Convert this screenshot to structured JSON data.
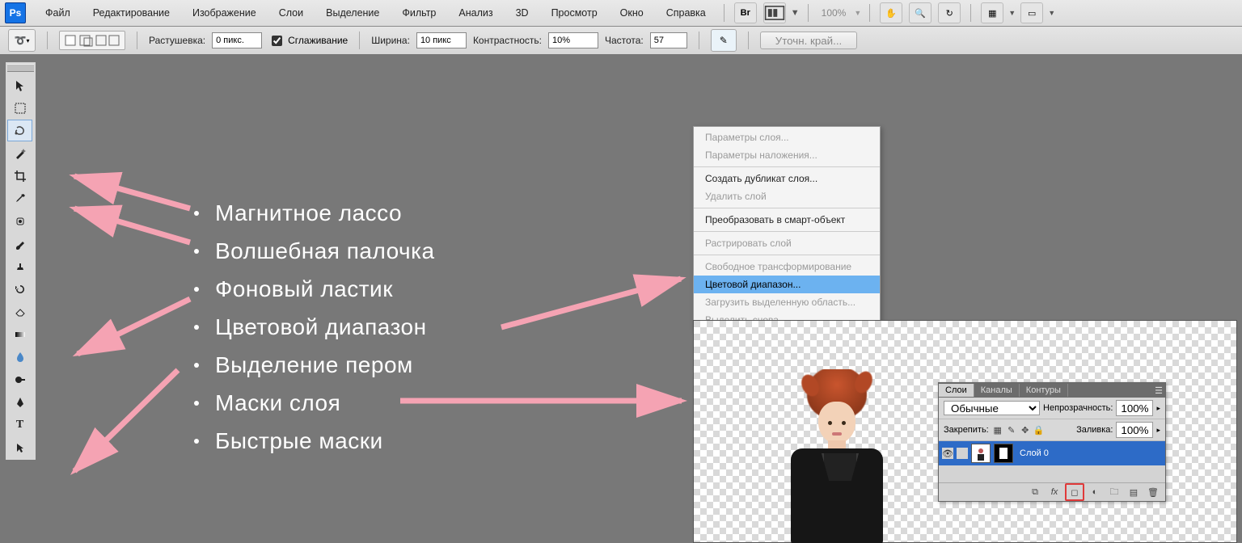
{
  "app": {
    "logo_text": "Ps"
  },
  "menu": {
    "items": [
      "Файл",
      "Редактирование",
      "Изображение",
      "Слои",
      "Выделение",
      "Фильтр",
      "Анализ",
      "3D",
      "Просмотр",
      "Окно",
      "Справка"
    ],
    "zoom": "100%"
  },
  "options": {
    "feather_label": "Растушевка:",
    "feather_value": "0 пикс.",
    "antialias_label": "Сглаживание",
    "width_label": "Ширина:",
    "width_value": "10 пикс",
    "contrast_label": "Контрастность:",
    "contrast_value": "10%",
    "frequency_label": "Частота:",
    "frequency_value": "57",
    "refine_btn": "Уточн. край..."
  },
  "overlay": {
    "items": [
      "Магнитное лассо",
      "Волшебная палочка",
      "Фоновый ластик",
      "Цветовой диапазон",
      "Выделение пером",
      "Маски слоя",
      "Быстрые маски"
    ]
  },
  "context_menu": {
    "items": [
      {
        "label": "Параметры слоя...",
        "disabled": true
      },
      {
        "label": "Параметры наложения...",
        "disabled": true
      },
      {
        "sep": true
      },
      {
        "label": "Создать дубликат слоя...",
        "disabled": false
      },
      {
        "label": "Удалить слой",
        "disabled": true
      },
      {
        "sep": true
      },
      {
        "label": "Преобразовать в смарт-объект",
        "disabled": false
      },
      {
        "sep": true
      },
      {
        "label": "Растрировать слой",
        "disabled": true
      },
      {
        "sep": true
      },
      {
        "label": "Свободное трансформирование",
        "disabled": true
      },
      {
        "label": "Цветовой диапазон...",
        "disabled": false,
        "highlighted": true
      },
      {
        "label": "Загрузить выделенную область...",
        "disabled": true
      },
      {
        "label": "Выделить снова",
        "disabled": true
      }
    ]
  },
  "layers_panel": {
    "tabs": [
      "Слои",
      "Каналы",
      "Контуры"
    ],
    "blend_label": "Обычные",
    "opacity_label": "Непрозрачность:",
    "opacity_value": "100%",
    "lock_label": "Закрепить:",
    "fill_label": "Заливка:",
    "fill_value": "100%",
    "layer0_name": "Слой 0"
  },
  "icons": {
    "bridge": "Br",
    "movie": "film",
    "hand": "✋",
    "zoom": "🔍",
    "rotate": "↻",
    "workspace": "▦",
    "screen": "▭",
    "move": "↖",
    "marquee": "▭",
    "lasso": "➰",
    "wand": "✨",
    "crop": "✂",
    "eyedropper": "⁄",
    "spot": "◒",
    "brush": "🖌",
    "stamp": "⎌",
    "history": "⟲",
    "eraser": "◧",
    "gradient": "▤",
    "blur": "⬮",
    "dodge": "◐",
    "pen": "✒",
    "type": "T",
    "path": "↗"
  }
}
